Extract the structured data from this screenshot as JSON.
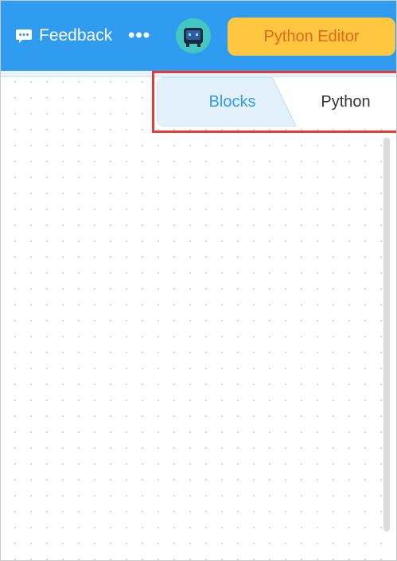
{
  "header": {
    "feedback_label": "Feedback",
    "more_label": "•••",
    "python_editor_label": "Python Editor"
  },
  "editor_tabs": {
    "blocks_label": "Blocks",
    "python_label": "Python",
    "active": "Blocks"
  },
  "colors": {
    "header_bg": "#2f9cf0",
    "accent_button": "#ffc640",
    "accent_button_text": "#e0691b",
    "active_tab_text": "#2f9cf0",
    "highlight_border": "#e53b3b"
  },
  "icons": {
    "feedback": "chat-bubble-icon",
    "more": "more-dots-icon",
    "avatar": "robot-avatar-icon"
  }
}
